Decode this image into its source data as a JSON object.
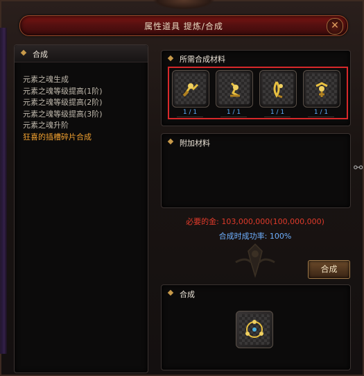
{
  "window": {
    "title": "属性道具 提炼/合成",
    "close_icon": "close-x-icon"
  },
  "left_panel": {
    "header": "合成",
    "items": [
      {
        "label": "元素之魂生成",
        "selected": false
      },
      {
        "label": "元素之魂等级提高(1阶)",
        "selected": false
      },
      {
        "label": "元素之魂等级提高(2阶)",
        "selected": false
      },
      {
        "label": "元素之魂等级提高(3阶)",
        "selected": false
      },
      {
        "label": "元素之魂升阶",
        "selected": false
      },
      {
        "label": "狂喜的插槽碎片合成",
        "selected": true
      }
    ]
  },
  "materials": {
    "header": "所需合成材料",
    "slots": [
      {
        "icon": "fragment-icon",
        "count": "1 / 1"
      },
      {
        "icon": "fragment-icon",
        "count": "1 / 1"
      },
      {
        "icon": "fragment-icon",
        "count": "1 / 1"
      },
      {
        "icon": "fragment-icon",
        "count": "1 / 1"
      }
    ]
  },
  "extra": {
    "header": "附加材料"
  },
  "info": {
    "required_gold": "必要的金: 103,000,000(100,000,000)",
    "success_rate": "合成时成功率: 100%"
  },
  "combine_button": "合成",
  "result": {
    "header": "合成",
    "icon": "socket-item-icon"
  },
  "colors": {
    "selected": "#f0a030",
    "count": "#5fb0ff",
    "gold_req": "#e03a2a",
    "rate": "#6fb0ff",
    "highlight_box": "#d8282a"
  }
}
